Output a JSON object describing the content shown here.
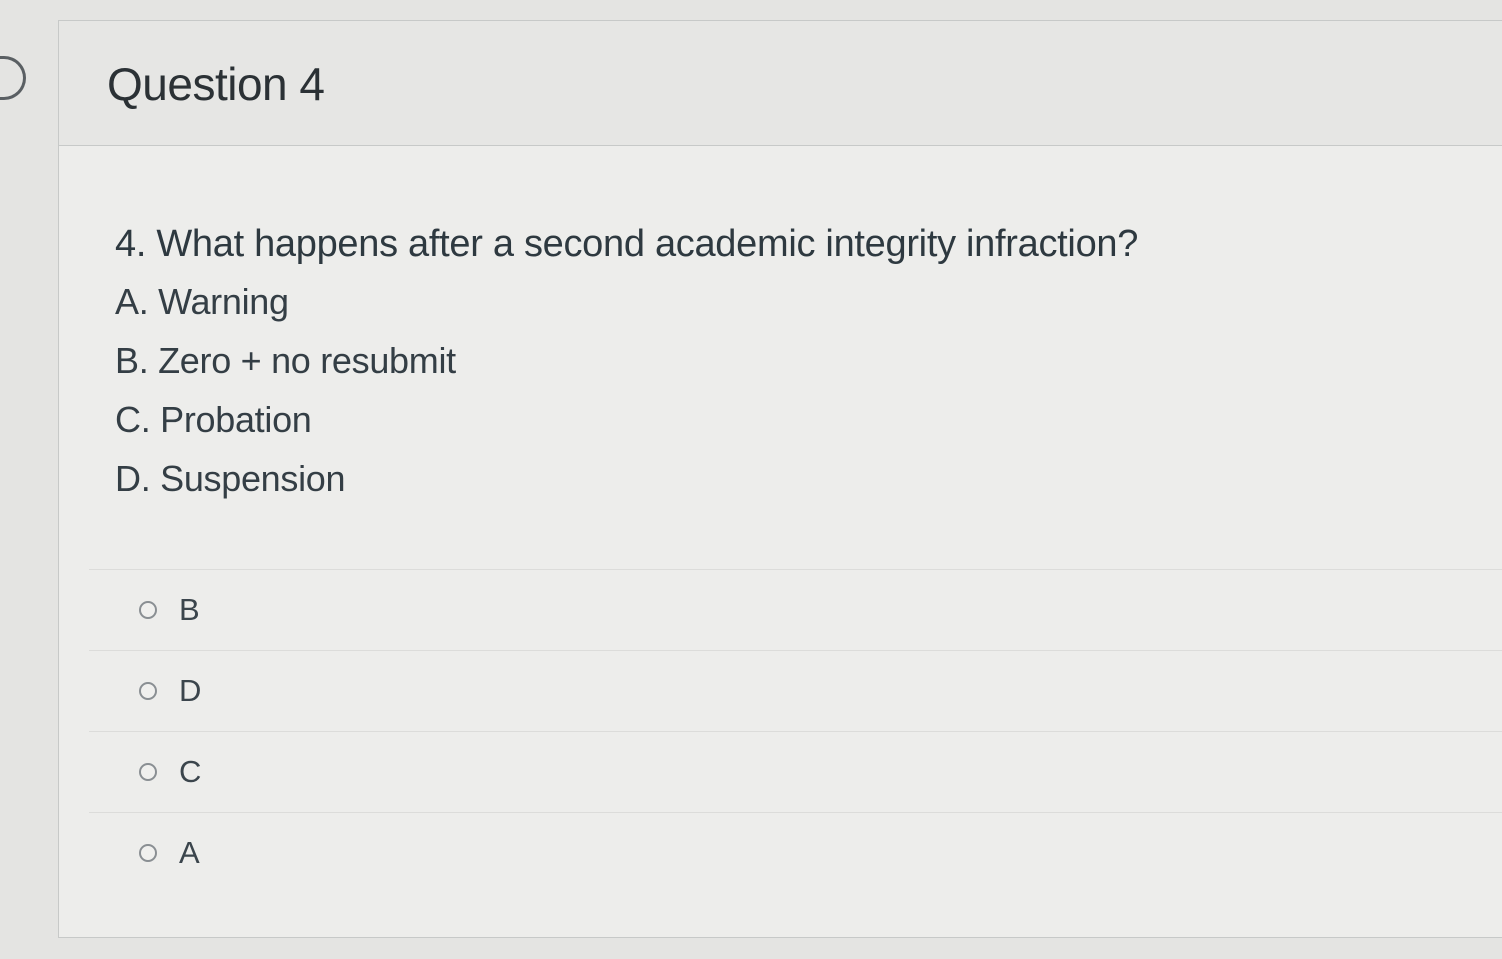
{
  "question": {
    "header_title": "Question 4",
    "text": "4. What happens after a second academic integrity infraction?",
    "choices": [
      "A. Warning",
      "B. Zero + no resubmit",
      "C. Probation",
      "D. Suspension"
    ]
  },
  "answers": [
    {
      "label": "B",
      "selected": false
    },
    {
      "label": "D",
      "selected": false
    },
    {
      "label": "C",
      "selected": false
    },
    {
      "label": "A",
      "selected": false
    }
  ]
}
